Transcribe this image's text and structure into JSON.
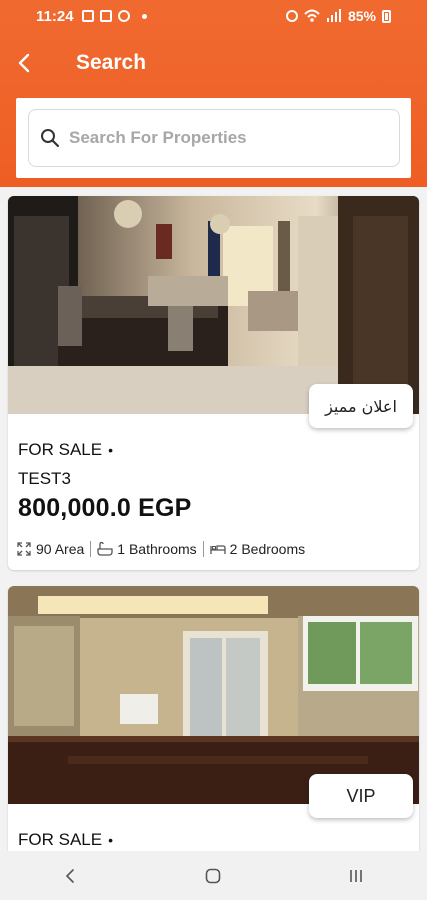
{
  "status_bar": {
    "time": "11:24",
    "battery": "85%"
  },
  "header": {
    "title": "Search",
    "back_icon": "chevron-left-icon"
  },
  "search": {
    "placeholder": "Search For Properties",
    "icon": "search-icon"
  },
  "listings": [
    {
      "status": "FOR SALE",
      "bullet": "•",
      "name": "TEST3",
      "price": "800,000.0 EGP",
      "badge": "اعلان مميز",
      "area": "90 Area",
      "bathrooms": "1 Bathrooms",
      "bedrooms": "2 Bedrooms"
    },
    {
      "status": "FOR SALE",
      "bullet": "•",
      "badge": "VIP"
    }
  ],
  "colors": {
    "accent": "#ee5e24",
    "background": "#f2f2f2",
    "card": "#ffffff"
  }
}
